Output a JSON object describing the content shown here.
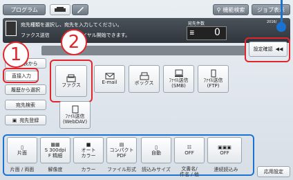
{
  "tabs": {
    "program": "プログラム",
    "function_search": "機能検索",
    "job_display": "ジョブ表示"
  },
  "header": {
    "message_line1": "宛先種類を選択し、宛先を入力してください。",
    "message_line2": "ファクス送信",
    "message_line2_tail": "ダイヤル開始できます。",
    "dest_count_label": "宛先件数",
    "dest_count": "0",
    "date_fragment": "2016/"
  },
  "confirm_button": "設定確認",
  "sidebar": {
    "from_address": "宛先表から",
    "direct_input": "直接入力",
    "from_history": "履歴から選択",
    "address_search": "宛先検索",
    "address_register": "宛先登録"
  },
  "destinations": [
    {
      "label": "ファクス"
    },
    {
      "label": "E-mail"
    },
    {
      "label": "ボックス"
    },
    {
      "label": "ﾌｧｲﾙ送信\n(SMB)"
    },
    {
      "label": "ﾌｧｲﾙ送信\n(FTP)"
    },
    {
      "label": "ﾌｧｲﾙ送信\n(WebDAV)"
    }
  ],
  "bottom_buttons": [
    {
      "top": "片面",
      "caption": "片面 / 両面"
    },
    {
      "top": "S 300dpi\nF 精細",
      "caption": "解像度"
    },
    {
      "top": "オート\nカラー",
      "caption": "カラー"
    },
    {
      "top": "コンパクト\nPDF",
      "caption": "ファイル形式"
    },
    {
      "top": "自動",
      "caption": "読込みサイズ"
    },
    {
      "top": "OFF",
      "caption": "文書名/\n件名 / 他"
    },
    {
      "top": "OFF",
      "caption": "連続読込み"
    }
  ],
  "app_settings": "応用設定",
  "annotations": {
    "step1": "1",
    "step2": "2"
  }
}
